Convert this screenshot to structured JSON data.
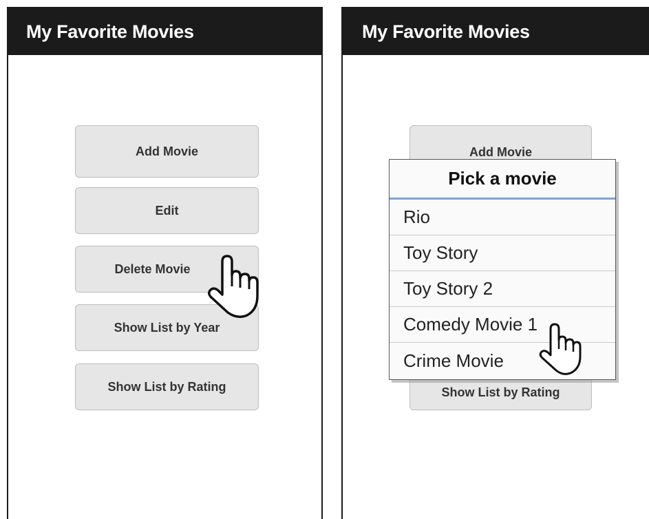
{
  "left_screen": {
    "title": "My Favorite Movies",
    "buttons": [
      {
        "label": "Add Movie"
      },
      {
        "label": "Edit"
      },
      {
        "label": "Delete Movie"
      },
      {
        "label": "Show List by Year"
      },
      {
        "label": "Show List by Rating"
      }
    ]
  },
  "right_screen": {
    "title": "My Favorite Movies",
    "buttons": [
      {
        "label": "Add Movie"
      },
      {
        "label": "Show List by Rating"
      }
    ],
    "picker": {
      "title": "Pick a movie",
      "items": [
        "Rio",
        "Toy Story",
        "Toy Story 2",
        "Comedy Movie 1",
        "Crime Movie"
      ]
    }
  },
  "icons": {
    "left_cursor": "hand-pointer-icon",
    "right_cursor": "hand-pointer-icon"
  }
}
